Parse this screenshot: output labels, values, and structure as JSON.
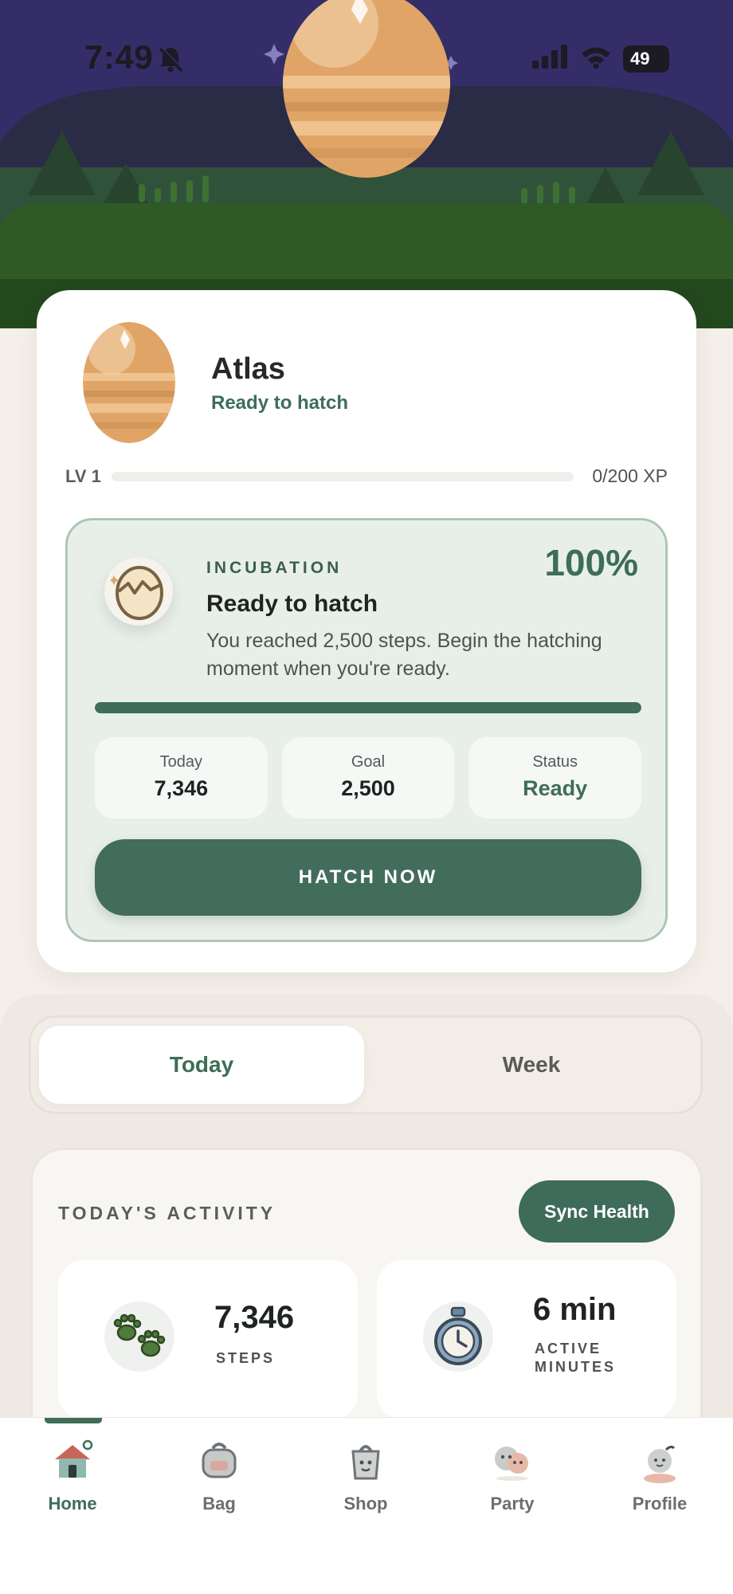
{
  "status_bar": {
    "time": "7:49",
    "battery": "49"
  },
  "pet": {
    "name": "Atlas",
    "status": "Ready to hatch",
    "level": "LV 1",
    "xp": "0/200 XP",
    "xp_fraction": 0.0
  },
  "incubation": {
    "kicker": "INCUBATION",
    "percent": "100%",
    "progress": 1.0,
    "title": "Ready to hatch",
    "description": "You reached 2,500 steps. Begin the hatching moment when you're ready.",
    "stats": [
      {
        "label": "Today",
        "value": "7,346"
      },
      {
        "label": "Goal",
        "value": "2,500"
      },
      {
        "label": "Status",
        "value": "Ready"
      }
    ],
    "button": "HATCH NOW"
  },
  "segment": {
    "today": "Today",
    "week": "Week",
    "selected": "Today"
  },
  "activity": {
    "title": "TODAY'S ACTIVITY",
    "sync": "Sync Health",
    "steps": {
      "value": "7,346",
      "label": "STEPS"
    },
    "active": {
      "value": "6 min",
      "label": "ACTIVE MINUTES"
    }
  },
  "tabs": [
    {
      "label": "Home",
      "icon": "house-icon"
    },
    {
      "label": "Bag",
      "icon": "backpack-icon"
    },
    {
      "label": "Shop",
      "icon": "shopping-bag-icon"
    },
    {
      "label": "Party",
      "icon": "party-icon"
    },
    {
      "label": "Profile",
      "icon": "profile-icon"
    }
  ],
  "colors": {
    "accent": "#3e6d58",
    "sky": "#352d68",
    "grass": "#2f5a26",
    "egg": "#e0a566"
  }
}
